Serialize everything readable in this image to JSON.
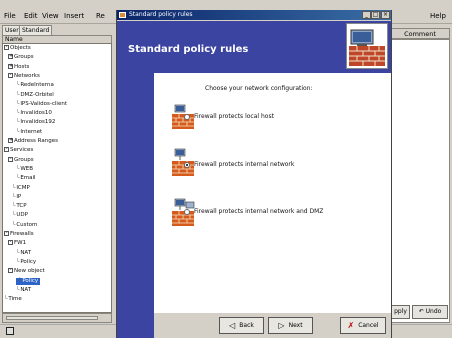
{
  "menubar": {
    "items": [
      "File",
      "Edit",
      "View",
      "Insert",
      "Re",
      "Help"
    ]
  },
  "left_panel": {
    "tabs": [
      "User",
      "Standard"
    ],
    "column_header": "Name",
    "tree": [
      {
        "label": "Objects",
        "exp": "-"
      },
      {
        "label": "Groups",
        "exp": "+"
      },
      {
        "label": "Hosts",
        "exp": "+"
      },
      {
        "label": "Networks",
        "exp": "-"
      },
      {
        "label": "RedeInterna"
      },
      {
        "label": "DMZ-Orbitel"
      },
      {
        "label": "IPS-Validos-client"
      },
      {
        "label": "Invalidos10"
      },
      {
        "label": "Invalidos192"
      },
      {
        "label": "Internet"
      },
      {
        "label": "Address Ranges",
        "exp": "+"
      },
      {
        "label": "Services",
        "exp": "-"
      },
      {
        "label": "Groups",
        "exp": "-"
      },
      {
        "label": "WEB"
      },
      {
        "label": "Email"
      },
      {
        "label": "ICMP"
      },
      {
        "label": "IP"
      },
      {
        "label": "TCP"
      },
      {
        "label": "UDP"
      },
      {
        "label": "Custom"
      },
      {
        "label": "Firewalls",
        "exp": "-"
      },
      {
        "label": "FW1",
        "exp": "-"
      },
      {
        "label": "NAT"
      },
      {
        "label": "Policy"
      },
      {
        "label": "New object",
        "exp": "-"
      },
      {
        "label": "Policy",
        "selected": true
      },
      {
        "label": "NAT"
      },
      {
        "label": "Time"
      }
    ]
  },
  "right_panel": {
    "column_header": "Comment",
    "apply_label": "pply",
    "undo_label": "Undo"
  },
  "dialog": {
    "title": "Standard policy rules",
    "minimize_glyph": "_",
    "maximize_glyph": "□",
    "close_glyph": "×",
    "heading": "Standard policy rules",
    "prompt": "Choose your network configuration:",
    "options": [
      {
        "label": "Firewall protects local host",
        "selected": false
      },
      {
        "label": "Firewall protects internal network",
        "selected": true
      },
      {
        "label": "Firewall protects internal network and DMZ",
        "selected": false
      }
    ],
    "buttons": {
      "back": "Back",
      "next": "Next",
      "cancel": "Cancel"
    }
  },
  "colors": {
    "dialog_header": "#3b44a0",
    "title_bar": "#0a246a",
    "selection": "#2b63c7"
  }
}
